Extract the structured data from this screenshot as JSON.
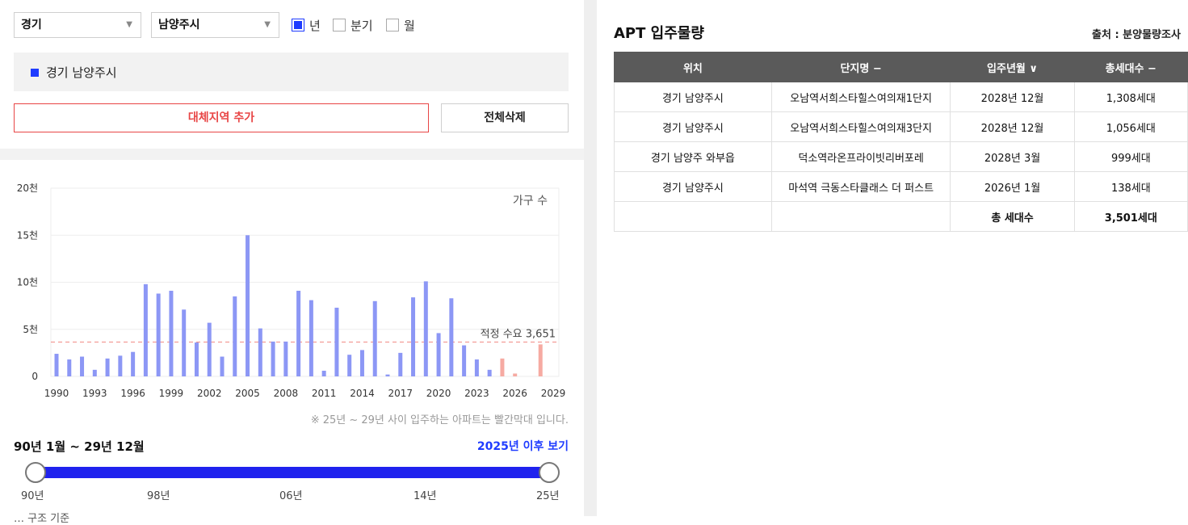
{
  "filters": {
    "province": "경기",
    "city": "남양주시",
    "period_options": [
      {
        "label": "년",
        "checked": true
      },
      {
        "label": "분기",
        "checked": false
      },
      {
        "label": "월",
        "checked": false
      }
    ]
  },
  "selected_region": "경기 남양주시",
  "buttons": {
    "add_region": "대체지역 추가",
    "clear_all": "전체삭제"
  },
  "chart_data": {
    "type": "bar",
    "legend_label": "가구 수",
    "y_ticks": [
      "0",
      "5천",
      "10천",
      "15천",
      "20천"
    ],
    "ylim": [
      0,
      20000
    ],
    "x_ticks": [
      "1990",
      "1993",
      "1996",
      "1999",
      "2002",
      "2005",
      "2008",
      "2011",
      "2014",
      "2017",
      "2020",
      "2023",
      "2026",
      "2029"
    ],
    "years": [
      1990,
      1991,
      1992,
      1993,
      1994,
      1995,
      1996,
      1997,
      1998,
      1999,
      2000,
      2001,
      2002,
      2003,
      2004,
      2005,
      2006,
      2007,
      2008,
      2009,
      2010,
      2011,
      2012,
      2013,
      2014,
      2015,
      2016,
      2017,
      2018,
      2019,
      2020,
      2021,
      2022,
      2023,
      2024,
      2025,
      2026,
      2027,
      2028,
      2029
    ],
    "values": [
      2400,
      1800,
      2100,
      700,
      1900,
      2200,
      2600,
      9800,
      8800,
      9100,
      7100,
      3600,
      5700,
      2100,
      8500,
      15000,
      5100,
      3700,
      3700,
      9100,
      8100,
      600,
      7300,
      2300,
      2800,
      8000,
      200,
      2500,
      8400,
      10100,
      4600,
      8300,
      3300,
      1800,
      700,
      1900,
      300,
      0,
      3400,
      0
    ],
    "highlight_from_year": 2025,
    "colors": {
      "normal": "#8c97f5",
      "future": "#f6aaa2",
      "reference_line": "#f28b86"
    },
    "reference_line": {
      "value": 3651,
      "label": "적정 수요 3,651"
    }
  },
  "chart_note": "※ 25년 ~ 29년 사이 입주하는 아파트는 빨간막대 입니다.",
  "period_range": "90년 1월 ~ 29년 12월",
  "after_2025_link": "2025년 이후 보기",
  "slider": {
    "labels": [
      "90년",
      "98년",
      "06년",
      "14년",
      "25년"
    ]
  },
  "bottom_partial_text": "… 구조 기준",
  "apt": {
    "title": "APT 입주물량",
    "source": "출처 : 분양물량조사",
    "headers": [
      "위치",
      "단지명 −",
      "입주년월 ∨",
      "총세대수 −"
    ],
    "rows": [
      [
        "경기 남양주시",
        "오남역서희스타힐스여의재1단지",
        "2028년 12월",
        "1,308세대"
      ],
      [
        "경기 남양주시",
        "오남역서희스타힐스여의재3단지",
        "2028년 12월",
        "1,056세대"
      ],
      [
        "경기 남양주 와부읍",
        "덕소역라온프라이빗리버포레",
        "2028년 3월",
        "999세대"
      ],
      [
        "경기 남양주시",
        "마석역 극동스타클래스 더 퍼스트",
        "2026년 1월",
        "138세대"
      ]
    ],
    "total_label": "총 세대수",
    "total_value": "3,501세대"
  }
}
